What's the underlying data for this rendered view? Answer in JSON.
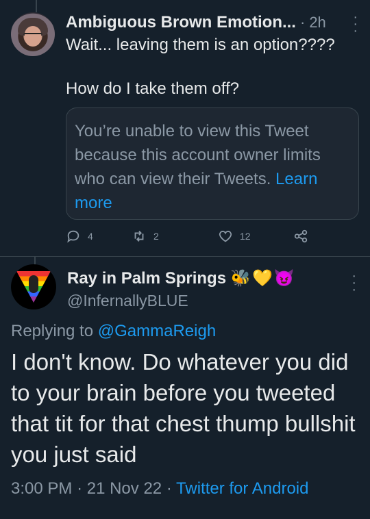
{
  "tweet1": {
    "author_name": "Ambiguous Brown Emotion...",
    "time": "2h",
    "separator": "·",
    "text_line1": "Wait... leaving them is an option????",
    "text_line2": "How do I take them off?",
    "quote_notice": "You’re unable to view this Tweet because this account owner limits who can view their Tweets.",
    "quote_learn_more": "Learn more",
    "actions": {
      "replies": "4",
      "retweets": "2",
      "likes": "12"
    }
  },
  "tweet2": {
    "author_name": "Ray in Palm Springs",
    "author_emojis": "🐝💛😈",
    "handle": "@InfernallyBLUE",
    "replying_prefix": "Replying to",
    "replying_mention": "@GammaReigh",
    "text": "I don't know. Do whatever you did to your brain before you tweeted that tit for that chest thump bullshit you just said",
    "time": "3:00 PM",
    "date": "21 Nov 22",
    "separator": "·",
    "source": "Twitter for Android"
  },
  "colors": {
    "background": "#15202b",
    "text_primary": "#e7e9ea",
    "text_secondary": "#8b98a5",
    "accent": "#1d9bf0",
    "border": "#38444d"
  },
  "icons": {
    "reply": "reply-icon",
    "retweet": "retweet-icon",
    "like": "heart-icon",
    "share": "share-icon",
    "more": "more-vertical-icon"
  }
}
